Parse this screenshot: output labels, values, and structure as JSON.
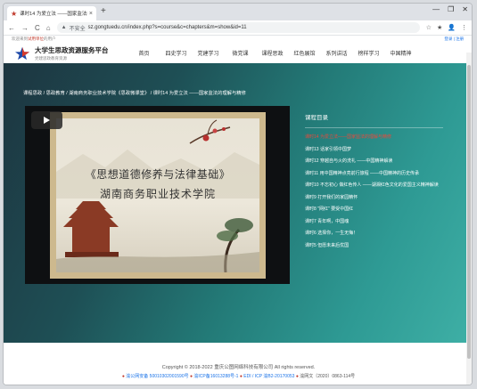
{
  "browser": {
    "tab_title": "课时14 为爱立法 ——国家监法的",
    "tab_close": "×",
    "new_tab": "+",
    "window_controls": [
      "—",
      "❐",
      "✕"
    ],
    "nav": [
      "←",
      "→",
      "C",
      "⌂"
    ],
    "security_label": "不安全",
    "url": "sz.gongtuedu.cn/index.php?s=course&c=chapters&m=show&id=11",
    "toolbar_icons": [
      "☆",
      "★",
      "👤",
      "⋮"
    ]
  },
  "site": {
    "top_left_prefix": "欢迎来到",
    "top_left_link": "试用单位",
    "top_left_suffix": "的用户",
    "top_right": "登录 | 注册",
    "brand_name": "大学生思政资源服务平台",
    "brand_sub": "党建思政教育资源",
    "nav": [
      "首页",
      "四史学习",
      "党建学习",
      "微党课",
      "课程思政",
      "红色展馆",
      "系列讲话",
      "榜样学习",
      "中国精神"
    ],
    "breadcrumb": "课程思政 / 思政教育 / 湖南商务职业技术学院《思政微课堂》 / 课时14 为爱立法 ——国家监法的理解与精修",
    "video_title_line1": "《思想道德修养与法律基础》",
    "video_title_line2": "湖南商务职业技术学院",
    "course_list_heading": "课程目录",
    "lessons": [
      "课时14 为爱立法——国家监法的理解与精修",
      "课时13 话家引领中国梦",
      "课时12 穿越自与火的洗礼 ——中国精神解读",
      "课时11 用中国精神点亮前行旅程 ——中国精神的历史传承",
      "课时10 不忘初心 做红色传人 ——湖湘红色文化的爱国主义精神解读",
      "课时9 打开我们的家园精怀",
      "课时8 \"网红\" 要受中国红",
      "课时7 青年啊，中国魂",
      "课时6 选择你，一生无悔！",
      "课时5 但愿未来后优国"
    ],
    "active_lesson_index": 0,
    "copyright": "Copyright © 2018-2022 重庆公图网络科技有限公司 All rights reserved.",
    "icp_parts": [
      "渝公网安备 50010302001590号",
      "渝ICP备16013288号-1",
      "EDI / ICP 渝B2-20170053",
      "渝网文〔2020〕0863-114号"
    ]
  },
  "colors": {
    "hero_start": "#1d3540",
    "hero_end": "#3fb0a6",
    "active_lesson": "#e84a3c"
  }
}
